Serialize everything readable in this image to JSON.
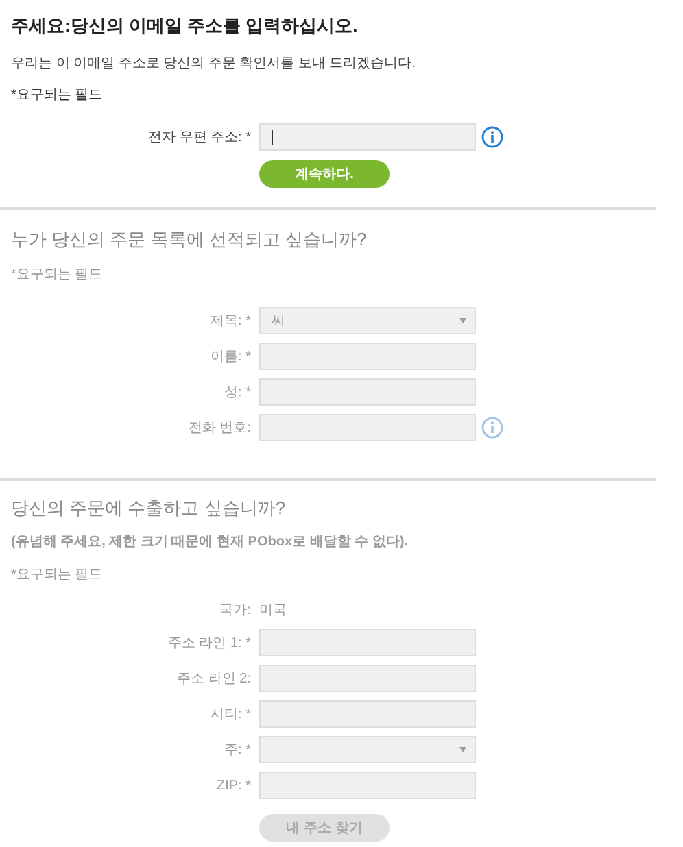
{
  "sections": [
    {
      "title": "주세요:당신의 이메일 주소를 입력하십시오.",
      "disabled": false,
      "description": "우리는 이 이메일 주소로 당신의 주문 확인서를 보내 드리겠습니다.",
      "required_note": "*요구되는 필드",
      "fields": [
        {
          "kind": "text",
          "label": "전자 우편 주소: *",
          "info": true
        }
      ],
      "button": {
        "label": "계속하다.",
        "disabled": false
      }
    },
    {
      "title": "누가 당신의 주문 목록에 선적되고 싶습니까?",
      "disabled": true,
      "required_note": "*요구되는 필드",
      "fields": [
        {
          "kind": "select",
          "label": "제목: *",
          "value": "씨",
          "info": false
        },
        {
          "kind": "text",
          "label": "이름: *",
          "info": false
        },
        {
          "kind": "text",
          "label": "성: *",
          "info": false
        },
        {
          "kind": "text",
          "label": "전화 번호:",
          "info": true
        }
      ]
    },
    {
      "title": "당신의 주문에 수출하고 싶습니까?",
      "disabled": true,
      "note": "(유념해 주세요, 제한 크기 때문에 현재 PObox로 배달할 수 없다).",
      "required_note": "*요구되는 필드",
      "fields": [
        {
          "kind": "static",
          "label": "국가:",
          "value": "미국",
          "info": false
        },
        {
          "kind": "text",
          "label": "주소 라인 1: *",
          "info": false
        },
        {
          "kind": "text",
          "label": "주소 라인 2:",
          "info": false
        },
        {
          "kind": "text",
          "label": "시티: *",
          "info": false
        },
        {
          "kind": "select",
          "label": "주: *",
          "info": false
        },
        {
          "kind": "text",
          "label": "ZIP: *",
          "info": false
        }
      ],
      "button": {
        "label": "내 주소 찾기",
        "disabled": true
      }
    }
  ]
}
